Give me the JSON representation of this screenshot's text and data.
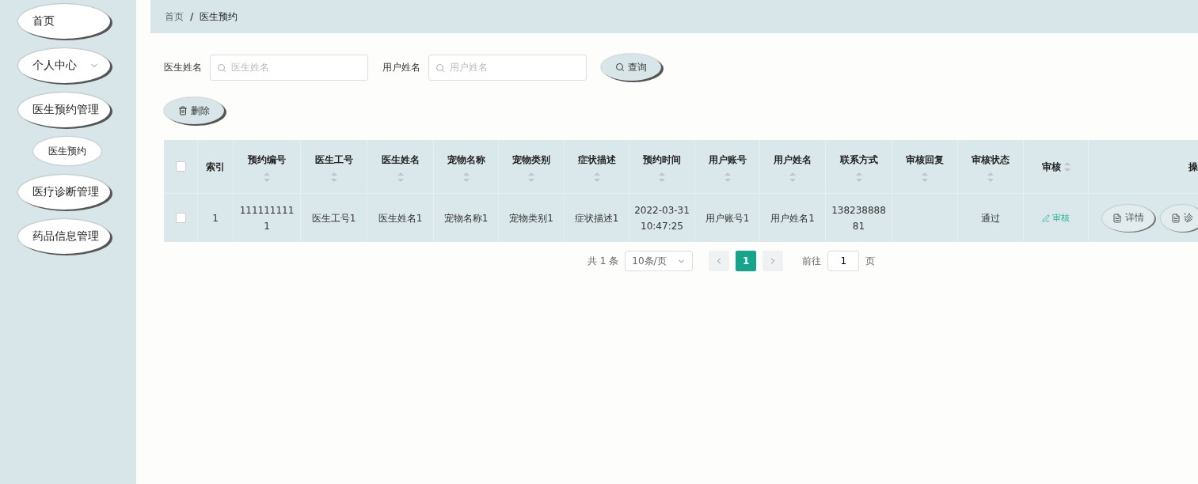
{
  "sidebar": {
    "items": [
      {
        "label": "首页",
        "has_caret": false
      },
      {
        "label": "个人中心",
        "has_caret": true
      },
      {
        "label": "医生预约管理",
        "has_caret": false,
        "children": [
          {
            "label": "医生预约",
            "selected": true
          }
        ]
      },
      {
        "label": "医疗诊断管理",
        "has_caret": false
      },
      {
        "label": "药品信息管理",
        "has_caret": false
      }
    ]
  },
  "breadcrumb": [
    "首页",
    "医生预约"
  ],
  "breadcrumb_separator": "/",
  "filters": [
    {
      "label": "医生姓名",
      "placeholder": "医生姓名"
    },
    {
      "label": "用户姓名",
      "placeholder": "用户姓名"
    }
  ],
  "search_button": "查询",
  "delete_button": "删除",
  "table": {
    "all_checked": false,
    "columns": [
      {
        "label": "索引",
        "sortable": false
      },
      {
        "label": "预约编号",
        "sortable": true
      },
      {
        "label": "医生工号",
        "sortable": true
      },
      {
        "label": "医生姓名",
        "sortable": true
      },
      {
        "label": "宠物名称",
        "sortable": true
      },
      {
        "label": "宠物类别",
        "sortable": true
      },
      {
        "label": "症状描述",
        "sortable": true
      },
      {
        "label": "预约时间",
        "sortable": true
      },
      {
        "label": "用户账号",
        "sortable": true
      },
      {
        "label": "用户姓名",
        "sortable": true
      },
      {
        "label": "联系方式",
        "sortable": true
      },
      {
        "label": "审核回复",
        "sortable": true
      },
      {
        "label": "审核状态",
        "sortable": true
      },
      {
        "label": "审核",
        "sortable": true
      },
      {
        "label": "操",
        "sortable": false
      }
    ],
    "rows": [
      {
        "checked": false,
        "cells": [
          "1",
          "1111111111",
          "医生工号1",
          "医生姓名1",
          "宠物名称1",
          "宠物类别1",
          "症状描述1",
          "2022-03-31 10:47:25",
          "用户账号1",
          "用户姓名1",
          "13823888881",
          "",
          "通过"
        ],
        "review_link": "审核",
        "actions": [
          "详情",
          "诊"
        ]
      }
    ]
  },
  "pagination": {
    "total": "共 1 条",
    "page_size": "10条/页",
    "pages": [
      {
        "label": "1",
        "selected": true
      }
    ],
    "goto_label": "前往",
    "goto_value": "1",
    "goto_suffix": "页"
  }
}
